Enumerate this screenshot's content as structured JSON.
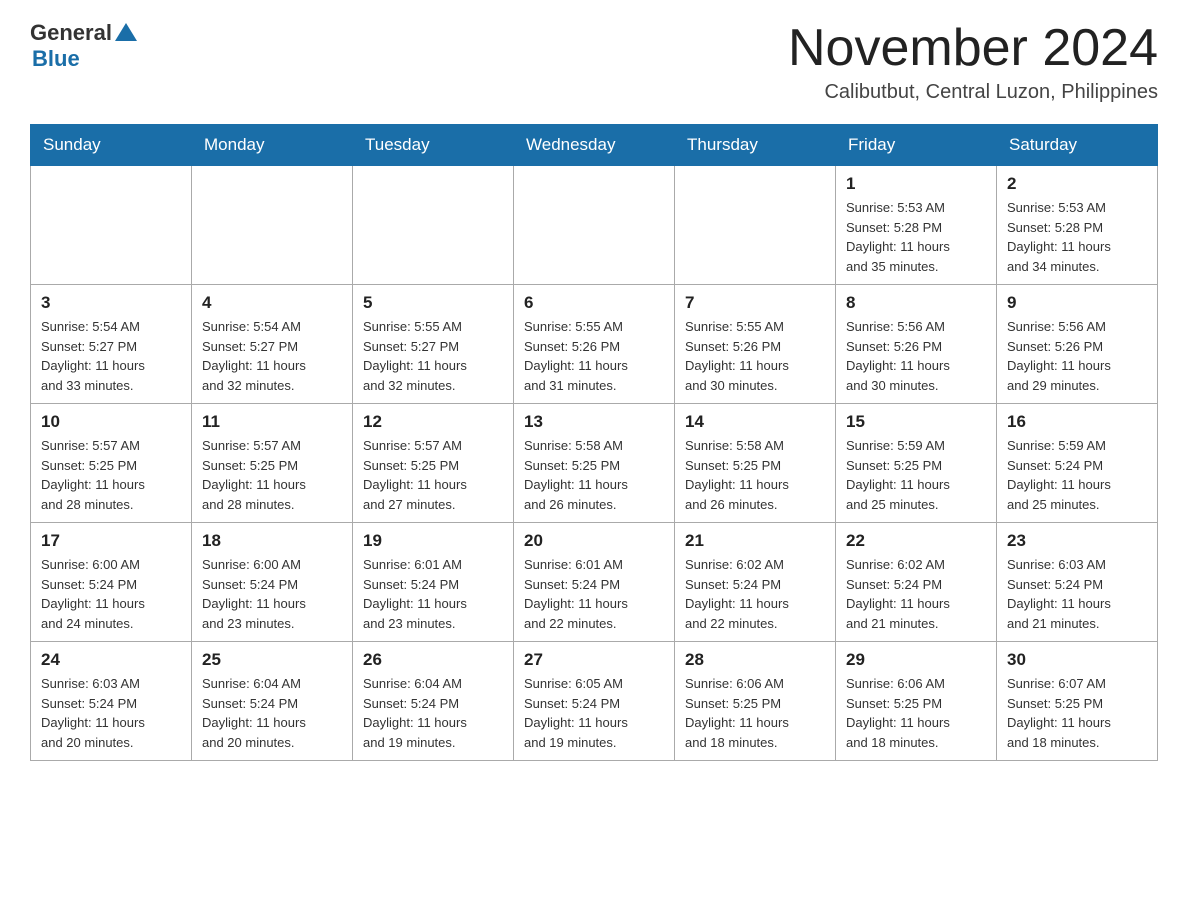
{
  "header": {
    "logo": {
      "general": "General",
      "triangle_color": "#1a6ea8",
      "blue": "Blue"
    },
    "title": "November 2024",
    "location": "Calibutbut, Central Luzon, Philippines"
  },
  "weekdays": [
    "Sunday",
    "Monday",
    "Tuesday",
    "Wednesday",
    "Thursday",
    "Friday",
    "Saturday"
  ],
  "weeks": [
    [
      {
        "day": "",
        "info": ""
      },
      {
        "day": "",
        "info": ""
      },
      {
        "day": "",
        "info": ""
      },
      {
        "day": "",
        "info": ""
      },
      {
        "day": "",
        "info": ""
      },
      {
        "day": "1",
        "info": "Sunrise: 5:53 AM\nSunset: 5:28 PM\nDaylight: 11 hours\nand 35 minutes."
      },
      {
        "day": "2",
        "info": "Sunrise: 5:53 AM\nSunset: 5:28 PM\nDaylight: 11 hours\nand 34 minutes."
      }
    ],
    [
      {
        "day": "3",
        "info": "Sunrise: 5:54 AM\nSunset: 5:27 PM\nDaylight: 11 hours\nand 33 minutes."
      },
      {
        "day": "4",
        "info": "Sunrise: 5:54 AM\nSunset: 5:27 PM\nDaylight: 11 hours\nand 32 minutes."
      },
      {
        "day": "5",
        "info": "Sunrise: 5:55 AM\nSunset: 5:27 PM\nDaylight: 11 hours\nand 32 minutes."
      },
      {
        "day": "6",
        "info": "Sunrise: 5:55 AM\nSunset: 5:26 PM\nDaylight: 11 hours\nand 31 minutes."
      },
      {
        "day": "7",
        "info": "Sunrise: 5:55 AM\nSunset: 5:26 PM\nDaylight: 11 hours\nand 30 minutes."
      },
      {
        "day": "8",
        "info": "Sunrise: 5:56 AM\nSunset: 5:26 PM\nDaylight: 11 hours\nand 30 minutes."
      },
      {
        "day": "9",
        "info": "Sunrise: 5:56 AM\nSunset: 5:26 PM\nDaylight: 11 hours\nand 29 minutes."
      }
    ],
    [
      {
        "day": "10",
        "info": "Sunrise: 5:57 AM\nSunset: 5:25 PM\nDaylight: 11 hours\nand 28 minutes."
      },
      {
        "day": "11",
        "info": "Sunrise: 5:57 AM\nSunset: 5:25 PM\nDaylight: 11 hours\nand 28 minutes."
      },
      {
        "day": "12",
        "info": "Sunrise: 5:57 AM\nSunset: 5:25 PM\nDaylight: 11 hours\nand 27 minutes."
      },
      {
        "day": "13",
        "info": "Sunrise: 5:58 AM\nSunset: 5:25 PM\nDaylight: 11 hours\nand 26 minutes."
      },
      {
        "day": "14",
        "info": "Sunrise: 5:58 AM\nSunset: 5:25 PM\nDaylight: 11 hours\nand 26 minutes."
      },
      {
        "day": "15",
        "info": "Sunrise: 5:59 AM\nSunset: 5:25 PM\nDaylight: 11 hours\nand 25 minutes."
      },
      {
        "day": "16",
        "info": "Sunrise: 5:59 AM\nSunset: 5:24 PM\nDaylight: 11 hours\nand 25 minutes."
      }
    ],
    [
      {
        "day": "17",
        "info": "Sunrise: 6:00 AM\nSunset: 5:24 PM\nDaylight: 11 hours\nand 24 minutes."
      },
      {
        "day": "18",
        "info": "Sunrise: 6:00 AM\nSunset: 5:24 PM\nDaylight: 11 hours\nand 23 minutes."
      },
      {
        "day": "19",
        "info": "Sunrise: 6:01 AM\nSunset: 5:24 PM\nDaylight: 11 hours\nand 23 minutes."
      },
      {
        "day": "20",
        "info": "Sunrise: 6:01 AM\nSunset: 5:24 PM\nDaylight: 11 hours\nand 22 minutes."
      },
      {
        "day": "21",
        "info": "Sunrise: 6:02 AM\nSunset: 5:24 PM\nDaylight: 11 hours\nand 22 minutes."
      },
      {
        "day": "22",
        "info": "Sunrise: 6:02 AM\nSunset: 5:24 PM\nDaylight: 11 hours\nand 21 minutes."
      },
      {
        "day": "23",
        "info": "Sunrise: 6:03 AM\nSunset: 5:24 PM\nDaylight: 11 hours\nand 21 minutes."
      }
    ],
    [
      {
        "day": "24",
        "info": "Sunrise: 6:03 AM\nSunset: 5:24 PM\nDaylight: 11 hours\nand 20 minutes."
      },
      {
        "day": "25",
        "info": "Sunrise: 6:04 AM\nSunset: 5:24 PM\nDaylight: 11 hours\nand 20 minutes."
      },
      {
        "day": "26",
        "info": "Sunrise: 6:04 AM\nSunset: 5:24 PM\nDaylight: 11 hours\nand 19 minutes."
      },
      {
        "day": "27",
        "info": "Sunrise: 6:05 AM\nSunset: 5:24 PM\nDaylight: 11 hours\nand 19 minutes."
      },
      {
        "day": "28",
        "info": "Sunrise: 6:06 AM\nSunset: 5:25 PM\nDaylight: 11 hours\nand 18 minutes."
      },
      {
        "day": "29",
        "info": "Sunrise: 6:06 AM\nSunset: 5:25 PM\nDaylight: 11 hours\nand 18 minutes."
      },
      {
        "day": "30",
        "info": "Sunrise: 6:07 AM\nSunset: 5:25 PM\nDaylight: 11 hours\nand 18 minutes."
      }
    ]
  ]
}
